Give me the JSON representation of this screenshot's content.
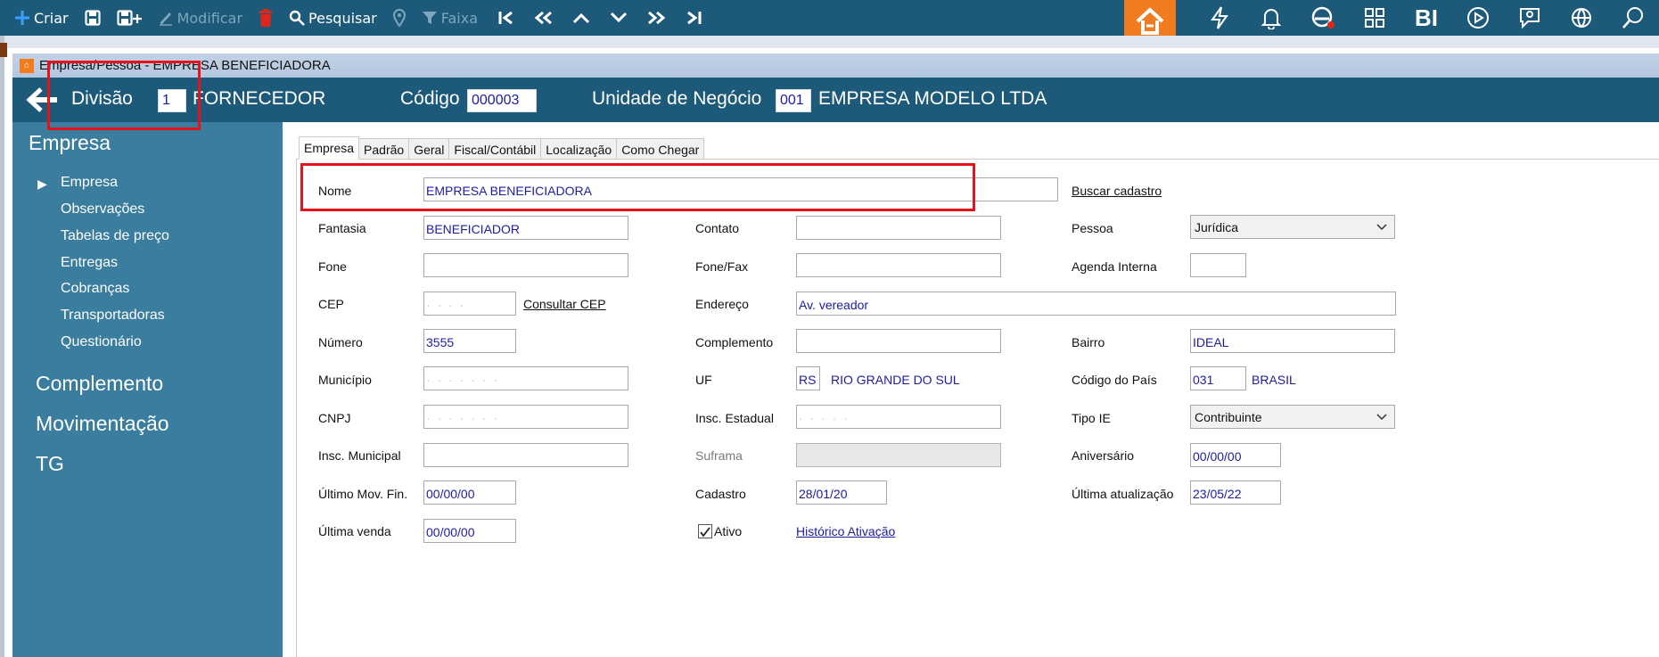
{
  "toolbar": {
    "criar": "Criar",
    "modificar": "Modificar",
    "pesquisar": "Pesquisar",
    "faixa": "Faixa",
    "bi": "BI",
    "colors": {
      "bar": "#1d5a7a",
      "home": "#f07c1f"
    }
  },
  "window": {
    "title": "Empresa/Pessoa - EMPRESA BENEFICIADORA"
  },
  "header": {
    "divisao_label": "Divisão",
    "divisao_value": "1",
    "divisao_name": "FORNECEDOR",
    "codigo_label": "Código",
    "codigo_value": "000003",
    "unidade_label": "Unidade de Negócio",
    "unidade_code": "001",
    "unidade_name": "EMPRESA MODELO LTDA"
  },
  "sidebar": {
    "sections": [
      "Empresa",
      "Complemento",
      "Movimentação",
      "TG"
    ],
    "items": [
      "Empresa",
      "Observações",
      "Tabelas de preço",
      "Entregas",
      "Cobranças",
      "Transportadoras",
      "Questionário"
    ]
  },
  "tabs": [
    "Empresa",
    "Padrão",
    "Geral",
    "Fiscal/Contábil",
    "Localização",
    "Como Chegar"
  ],
  "form": {
    "nome_label": "Nome",
    "nome_value": "EMPRESA BENEFICIADORA",
    "buscar_cadastro": "Buscar cadastro",
    "fantasia_label": "Fantasia",
    "fantasia_value": "BENEFICIADOR",
    "contato_label": "Contato",
    "contato_value": "",
    "pessoa_label": "Pessoa",
    "pessoa_value": "Jurídica",
    "fone_label": "Fone",
    "fone_value": "",
    "fonefax_label": "Fone/Fax",
    "fonefax_value": "",
    "agenda_label": "Agenda Interna",
    "agenda_value": "",
    "cep_label": "CEP",
    "consultar_cep": "Consultar CEP",
    "endereco_label": "Endereço",
    "endereco_value": "Av. vereador",
    "numero_label": "Número",
    "numero_value": "3555",
    "complemento_label": "Complemento",
    "complemento_value": "",
    "bairro_label": "Bairro",
    "bairro_value": "IDEAL",
    "municipio_label": "Município",
    "uf_label": "UF",
    "uf_value": "RS",
    "uf_name": "RIO GRANDE DO SUL",
    "codpais_label": "Código do País",
    "codpais_value": "031",
    "pais_name": "BRASIL",
    "cnpj_label": "CNPJ",
    "inscest_label": "Insc. Estadual",
    "tipoie_label": "Tipo IE",
    "tipoie_value": "Contribuinte",
    "inscmun_label": "Insc. Municipal",
    "inscmun_value": "",
    "suframa_label": "Suframa",
    "aniversario_label": "Aniversário",
    "aniversario_value": "00/00/00",
    "ultmovfin_label": "Último Mov. Fin.",
    "ultmovfin_value": "00/00/00",
    "cadastro_label": "Cadastro",
    "cadastro_value": "28/01/20",
    "ultatual_label": "Última atualização",
    "ultatual_value": "23/05/22",
    "ultvenda_label": "Última venda",
    "ultvenda_value": "00/00/00",
    "ativo_label": "Ativo",
    "ativo_checked": true,
    "historico_ativacao": "Histórico Ativação"
  }
}
